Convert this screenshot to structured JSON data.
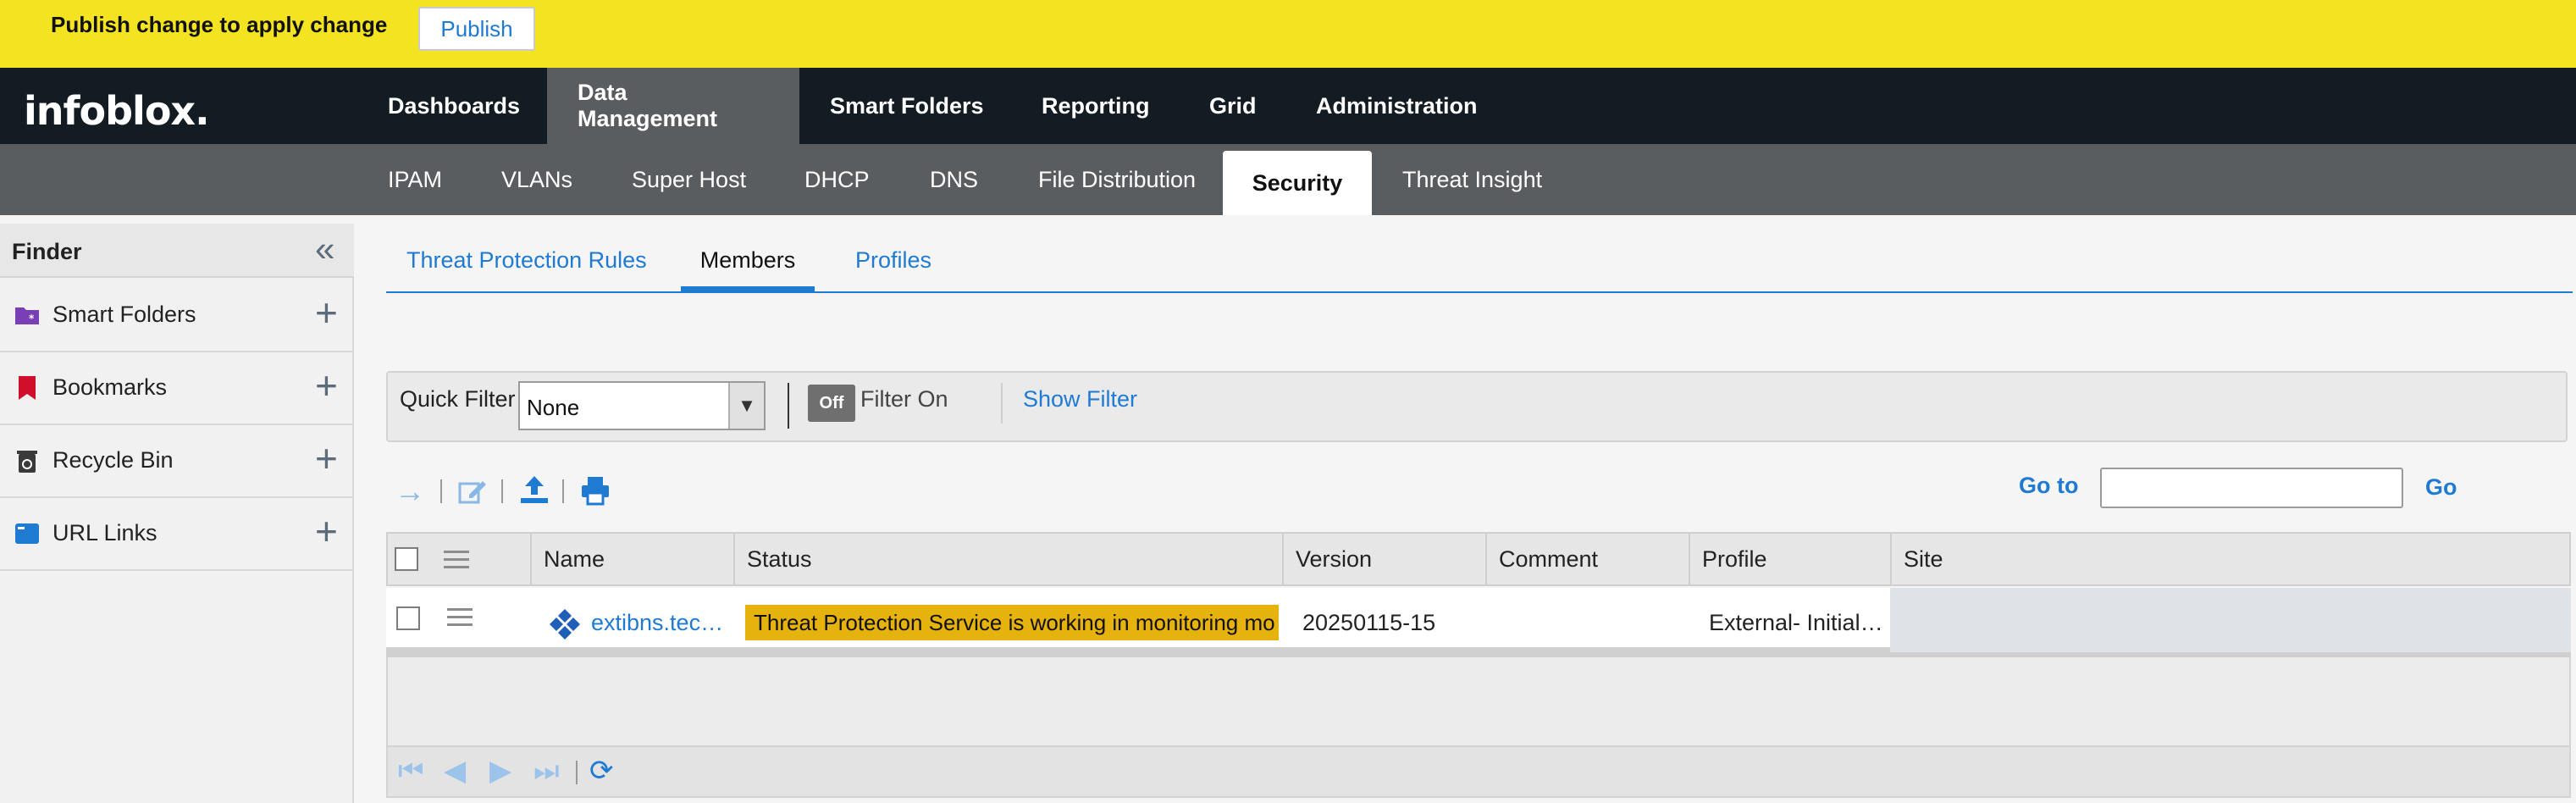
{
  "banner": {
    "message": "Publish change to apply change",
    "publish_label": "Publish"
  },
  "brand": {
    "logo_text": "infoblox."
  },
  "top_nav": [
    {
      "label": "Dashboards"
    },
    {
      "label": "Data Management",
      "active": true
    },
    {
      "label": "Smart Folders"
    },
    {
      "label": "Reporting"
    },
    {
      "label": "Grid"
    },
    {
      "label": "Administration"
    }
  ],
  "sub_nav": [
    {
      "label": "IPAM"
    },
    {
      "label": "VLANs"
    },
    {
      "label": "Super Host"
    },
    {
      "label": "DHCP"
    },
    {
      "label": "DNS"
    },
    {
      "label": "File Distribution"
    },
    {
      "label": "Security",
      "active": true
    },
    {
      "label": "Threat Insight"
    }
  ],
  "finder": {
    "title": "Finder",
    "items": [
      {
        "label": "Smart Folders",
        "icon": "smart-folder-icon"
      },
      {
        "label": "Bookmarks",
        "icon": "bookmark-icon"
      },
      {
        "label": "Recycle Bin",
        "icon": "recycle-bin-icon"
      },
      {
        "label": "URL Links",
        "icon": "url-link-icon"
      }
    ]
  },
  "content_tabs": [
    {
      "label": "Threat Protection Rules"
    },
    {
      "label": "Members",
      "active": true
    },
    {
      "label": "Profiles"
    }
  ],
  "filter": {
    "quick_filter_label": "Quick Filter",
    "quick_filter_value": "None",
    "toggle_label": "Off",
    "filter_on_label": "Filter On",
    "show_filter_label": "Show Filter"
  },
  "goto": {
    "label": "Go to",
    "value": "",
    "go_label": "Go"
  },
  "table": {
    "columns": [
      "Name",
      "Status",
      "Version",
      "Comment",
      "Profile",
      "Site"
    ],
    "rows": [
      {
        "name": "extibns.tec…",
        "status": "Threat Protection Service is working in monitoring mo",
        "version": "20250115-15",
        "comment": "",
        "profile": "External- Initial…",
        "site": ""
      }
    ]
  },
  "colors": {
    "banner": "#f3e321",
    "nav_dark": "#121c22",
    "subnav": "#5a5d60",
    "accent": "#1f7ad1",
    "status_badge": "#e6b20d"
  }
}
